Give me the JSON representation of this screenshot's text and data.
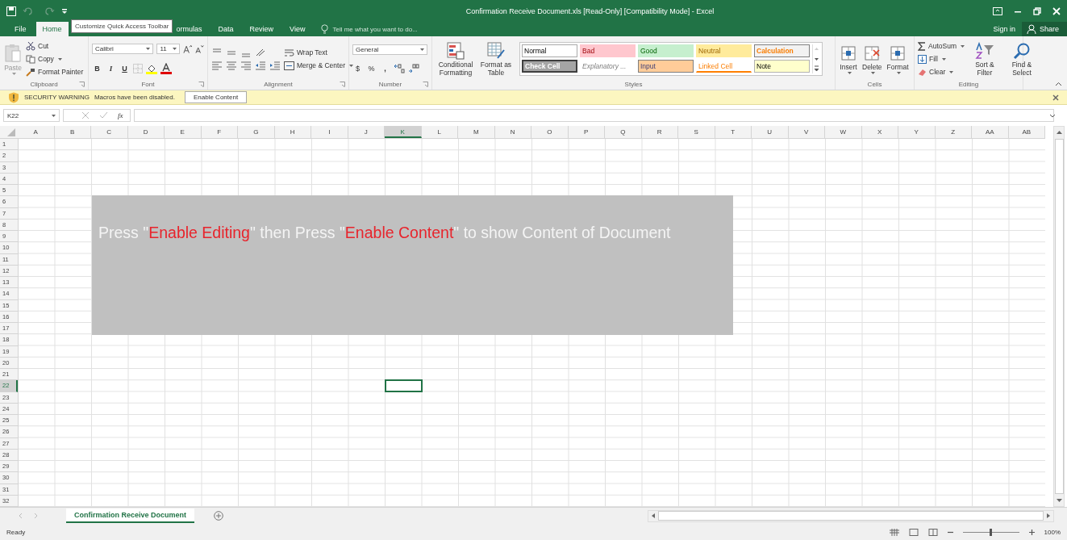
{
  "window": {
    "title": "Confirmation Receive Document.xls  [Read-Only]  [Compatibility Mode] - Excel"
  },
  "tooltip": {
    "text": "Customize Quick Access Toolbar"
  },
  "tabs": [
    {
      "label": "File",
      "selected": false
    },
    {
      "label": "Home",
      "selected": true
    },
    {
      "label": "ormulas",
      "selected": false
    },
    {
      "label": "Data",
      "selected": false
    },
    {
      "label": "Review",
      "selected": false
    },
    {
      "label": "View",
      "selected": false
    }
  ],
  "tell_me": {
    "placeholder": "Tell me what you want to do..."
  },
  "account": {
    "sign_in": "Sign in",
    "share": "Share"
  },
  "clipboard": {
    "label": "Clipboard",
    "paste": "Paste",
    "cut": "Cut",
    "copy": "Copy",
    "format_painter": "Format Painter"
  },
  "font": {
    "label": "Font",
    "family": "Calibri",
    "size": "11",
    "bold": "B",
    "italic": "I",
    "underline": "U"
  },
  "alignment": {
    "label": "Alignment",
    "wrap": "Wrap Text",
    "merge": "Merge & Center"
  },
  "number": {
    "label": "Number",
    "format": "General",
    "currency": "$",
    "percent": "%",
    "comma": ","
  },
  "styles": {
    "label": "Styles",
    "conditional": "Conditional Formatting",
    "format_table": "Format as Table",
    "cells": [
      {
        "label": "Normal",
        "kind": "normal"
      },
      {
        "label": "Bad",
        "kind": "bad"
      },
      {
        "label": "Good",
        "kind": "good"
      },
      {
        "label": "Neutral",
        "kind": "neutral"
      },
      {
        "label": "Calculation",
        "kind": "calculation"
      },
      {
        "label": "Check Cell",
        "kind": "check"
      },
      {
        "label": "Explanatory ...",
        "kind": "explanatory"
      },
      {
        "label": "Input",
        "kind": "input"
      },
      {
        "label": "Linked Cell",
        "kind": "linked"
      },
      {
        "label": "Note",
        "kind": "note"
      }
    ]
  },
  "cells_group": {
    "label": "Cells",
    "buttons": [
      "Insert",
      "Delete",
      "Format"
    ]
  },
  "editing": {
    "label": "Editing",
    "autosum": "AutoSum",
    "fill": "Fill",
    "clear": "Clear",
    "sort": "Sort & Filter",
    "find": "Find & Select"
  },
  "security_bar": {
    "title": "SECURITY WARNING",
    "message": "Macros have been disabled.",
    "button": "Enable Content"
  },
  "formula_bar": {
    "name_box": "K22",
    "function_label": "fx"
  },
  "grid": {
    "columns": [
      {
        "label": "A",
        "selected": false
      },
      {
        "label": "B",
        "selected": false
      },
      {
        "label": "C",
        "selected": false
      },
      {
        "label": "D",
        "selected": false
      },
      {
        "label": "E",
        "selected": false
      },
      {
        "label": "F",
        "selected": false
      },
      {
        "label": "G",
        "selected": false
      },
      {
        "label": "H",
        "selected": false
      },
      {
        "label": "I",
        "selected": false
      },
      {
        "label": "J",
        "selected": false
      },
      {
        "label": "K",
        "selected": true
      },
      {
        "label": "L",
        "selected": false
      },
      {
        "label": "M",
        "selected": false
      },
      {
        "label": "N",
        "selected": false
      },
      {
        "label": "O",
        "selected": false
      },
      {
        "label": "P",
        "selected": false
      },
      {
        "label": "Q",
        "selected": false
      },
      {
        "label": "R",
        "selected": false
      },
      {
        "label": "S",
        "selected": false
      },
      {
        "label": "T",
        "selected": false
      },
      {
        "label": "U",
        "selected": false
      },
      {
        "label": "V",
        "selected": false
      },
      {
        "label": "W",
        "selected": false
      },
      {
        "label": "X",
        "selected": false
      },
      {
        "label": "Y",
        "selected": false
      },
      {
        "label": "Z",
        "selected": false
      },
      {
        "label": "AA",
        "selected": false
      },
      {
        "label": "AB",
        "selected": false
      }
    ],
    "rows": [
      {
        "label": "1",
        "selected": false
      },
      {
        "label": "2",
        "selected": false
      },
      {
        "label": "3",
        "selected": false
      },
      {
        "label": "4",
        "selected": false
      },
      {
        "label": "5",
        "selected": false
      },
      {
        "label": "6",
        "selected": false
      },
      {
        "label": "7",
        "selected": false
      },
      {
        "label": "8",
        "selected": false
      },
      {
        "label": "9",
        "selected": false
      },
      {
        "label": "10",
        "selected": false
      },
      {
        "label": "11",
        "selected": false
      },
      {
        "label": "12",
        "selected": false
      },
      {
        "label": "13",
        "selected": false
      },
      {
        "label": "14",
        "selected": false
      },
      {
        "label": "15",
        "selected": false
      },
      {
        "label": "16",
        "selected": false
      },
      {
        "label": "17",
        "selected": false
      },
      {
        "label": "18",
        "selected": false
      },
      {
        "label": "19",
        "selected": false
      },
      {
        "label": "20",
        "selected": false
      },
      {
        "label": "21",
        "selected": false
      },
      {
        "label": "22",
        "selected": true
      },
      {
        "label": "23",
        "selected": false
      },
      {
        "label": "24",
        "selected": false
      },
      {
        "label": "25",
        "selected": false
      },
      {
        "label": "26",
        "selected": false
      },
      {
        "label": "27",
        "selected": false
      },
      {
        "label": "28",
        "selected": false
      },
      {
        "label": "29",
        "selected": false
      },
      {
        "label": "30",
        "selected": false
      },
      {
        "label": "31",
        "selected": false
      },
      {
        "label": "32",
        "selected": false
      }
    ]
  },
  "overlay": {
    "parts": [
      {
        "text": "Press \"",
        "kind": "plain"
      },
      {
        "text": "Enable Editing",
        "kind": "highlight"
      },
      {
        "text": "\" then Press \"",
        "kind": "plain"
      },
      {
        "text": "Enable Content",
        "kind": "highlight"
      },
      {
        "text": "\" to show Content of Document",
        "kind": "plain"
      }
    ]
  },
  "sheet_tabs": [
    {
      "label": "Confirmation Receive Document",
      "selected": true
    }
  ],
  "status_bar": {
    "text": "Ready",
    "zoom": "100%",
    "zoom_slider": {
      "level": 0.5
    }
  }
}
